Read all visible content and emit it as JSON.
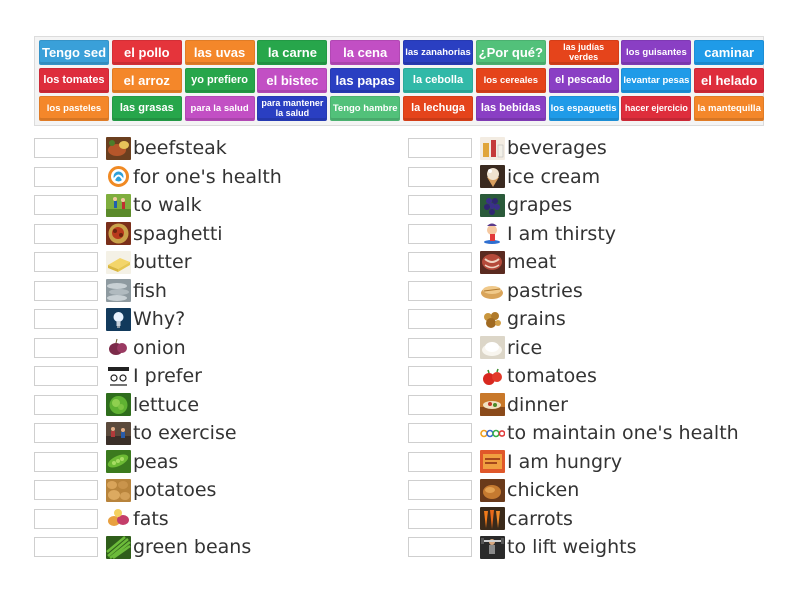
{
  "word_bank": [
    {
      "text": "Tengo sed",
      "color": "#3aa0d9"
    },
    {
      "text": "el pollo",
      "color": "#e5343b"
    },
    {
      "text": "las uvas",
      "color": "#f4872a"
    },
    {
      "text": "la carne",
      "color": "#27a64b"
    },
    {
      "text": "la cena",
      "color": "#c24fc4"
    },
    {
      "text": "las zanahorias",
      "color": "#2a3fc2"
    },
    {
      "text": "¿Por qué?",
      "color": "#52c17a"
    },
    {
      "text": "las judías verdes",
      "color": "#e5441b"
    },
    {
      "text": "los guisantes",
      "color": "#8a3fc4"
    },
    {
      "text": "caminar",
      "color": "#1f9be8"
    },
    {
      "text": "los tomates",
      "color": "#de2d3c"
    },
    {
      "text": "el arroz",
      "color": "#f4872a"
    },
    {
      "text": "yo prefiero",
      "color": "#27a64b"
    },
    {
      "text": "el bistec",
      "color": "#c24fc4"
    },
    {
      "text": "las papas",
      "color": "#2a3fc2"
    },
    {
      "text": "la cebolla",
      "color": "#31b9a8"
    },
    {
      "text": "los cereales",
      "color": "#e5441b"
    },
    {
      "text": "el pescado",
      "color": "#8a3fc4"
    },
    {
      "text": "levantar pesas",
      "color": "#1f9be8"
    },
    {
      "text": "el helado",
      "color": "#de2d3c"
    },
    {
      "text": "los pasteles",
      "color": "#f4872a"
    },
    {
      "text": "las grasas",
      "color": "#27a64b"
    },
    {
      "text": "para la salud",
      "color": "#c24fc4"
    },
    {
      "text": "para mantener la salud",
      "color": "#2a3fc2"
    },
    {
      "text": "Tengo hambre",
      "color": "#52c17a"
    },
    {
      "text": "la lechuga",
      "color": "#e5441b"
    },
    {
      "text": "las bebidas",
      "color": "#8a3fc4"
    },
    {
      "text": "los espaguetis",
      "color": "#1f9be8"
    },
    {
      "text": "hacer ejercicio",
      "color": "#de2d3c"
    },
    {
      "text": "la mantequilla",
      "color": "#f4872a"
    }
  ],
  "left_column": [
    {
      "label": "beefsteak",
      "icon": "beefsteak-photo"
    },
    {
      "label": "for one's health",
      "icon": "health-logo"
    },
    {
      "label": "to walk",
      "icon": "walking-photo"
    },
    {
      "label": "spaghetti",
      "icon": "spaghetti-photo"
    },
    {
      "label": "butter",
      "icon": "butter-photo"
    },
    {
      "label": "fish",
      "icon": "fish-photo"
    },
    {
      "label": "Why?",
      "icon": "lightbulb-photo"
    },
    {
      "label": "onion",
      "icon": "onion-photo"
    },
    {
      "label": "I prefer",
      "icon": "prefer-sketch"
    },
    {
      "label": "lettuce",
      "icon": "lettuce-photo"
    },
    {
      "label": "to exercise",
      "icon": "exercise-photo"
    },
    {
      "label": "peas",
      "icon": "peas-photo"
    },
    {
      "label": "potatoes",
      "icon": "potatoes-photo"
    },
    {
      "label": "fats",
      "icon": "fats-photo"
    },
    {
      "label": "green beans",
      "icon": "green-beans-photo"
    }
  ],
  "right_column": [
    {
      "label": "beverages",
      "icon": "beverages-photo"
    },
    {
      "label": "ice cream",
      "icon": "ice-cream-photo"
    },
    {
      "label": "grapes",
      "icon": "grapes-photo"
    },
    {
      "label": "I am thirsty",
      "icon": "thirsty-cartoon"
    },
    {
      "label": "meat",
      "icon": "meat-photo"
    },
    {
      "label": "pastries",
      "icon": "pastries-photo"
    },
    {
      "label": "grains",
      "icon": "grains-photo"
    },
    {
      "label": "rice",
      "icon": "rice-photo"
    },
    {
      "label": "tomatoes",
      "icon": "tomatoes-photo"
    },
    {
      "label": "dinner",
      "icon": "dinner-photo"
    },
    {
      "label": "to maintain one's health",
      "icon": "health-rings-logo"
    },
    {
      "label": "I am hungry",
      "icon": "hungry-sign"
    },
    {
      "label": "chicken",
      "icon": "chicken-photo"
    },
    {
      "label": "carrots",
      "icon": "carrots-photo"
    },
    {
      "label": "to lift weights",
      "icon": "weights-photo"
    }
  ]
}
